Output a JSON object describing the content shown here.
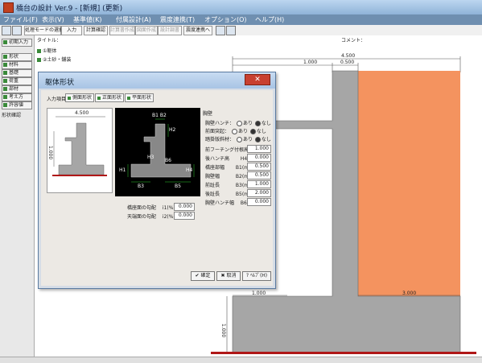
{
  "window": {
    "title": "橋台の設計 Ver.9 - [新規] (更新)"
  },
  "menu": [
    "ファイル(F)",
    "表示(V)",
    "基準値(K)",
    "付属設計(A)",
    "震度連携(T)",
    "オプション(O)",
    "ヘルプ(H)"
  ],
  "toolbar": {
    "mode_label": "処理モードの選択",
    "input": "入力",
    "calc_confirm": "計算確認",
    "result1": "計算書作成",
    "result2": "図面作成",
    "result3": "設計調書",
    "quake": "震度連携へ"
  },
  "left": {
    "initial": "初期入力",
    "items": [
      "形状",
      "材料",
      "基礎",
      "荷重",
      "部材",
      "考え方",
      "許容値"
    ],
    "shape_confirm": "形状確認"
  },
  "header": {
    "title_col": "タイトル：",
    "comment_col": "コメント："
  },
  "tree": [
    "①躯体",
    "②土砂・舗装"
  ],
  "dims": {
    "top_total": "4.500",
    "top_left": "1.000",
    "top_right": "0.500",
    "bottom_left": "1.000",
    "bottom_right": "3.000",
    "side_bottom": "1.000"
  },
  "dialog": {
    "title": "躯体形状",
    "input_items_label": "入力項目：",
    "tabs": [
      "側面形状",
      "正面形状",
      "平面形状"
    ],
    "thumb_dim_top": "4.500",
    "thumb_dim_side": "1.000",
    "schematic_labels": {
      "b1b2": "B1 B2",
      "h2": "H2",
      "h1": "H1",
      "b3": "B3",
      "b5": "B5",
      "b6": "B6",
      "h3": "H3",
      "h4": "H4"
    },
    "props_title": "胸壁",
    "radios": [
      {
        "label": "胸壁ハンチ：",
        "opt1": "あり",
        "opt2": "なし"
      },
      {
        "label": "前面突起：",
        "opt1": "あり",
        "opt2": "なし"
      },
      {
        "label": "踏掛版斜材：",
        "opt1": "あり",
        "opt2": "なし"
      }
    ],
    "params": [
      {
        "label": "前フーチング付根高 H1(m)",
        "value": "1.000"
      },
      {
        "label": "後ハンチ高　　 H4(m)",
        "value": "0.000"
      },
      {
        "label": "橋座部幅　　 B1(m)",
        "value": "0.500"
      },
      {
        "label": "胸壁幅　　　 B2(m)",
        "value": "0.500"
      },
      {
        "label": "前趾長　　　 B3(m)",
        "value": "1.000"
      },
      {
        "label": "後趾長　　　 B5(m)",
        "value": "2.000"
      },
      {
        "label": "胸壁ハンチ幅　 B6(m)",
        "value": "0.000"
      }
    ],
    "slopes": [
      {
        "label": "橋座面の勾配　 i1(%)",
        "value": "0.000"
      },
      {
        "label": "天端面の勾配　 i2(%)",
        "value": "0.000"
      }
    ],
    "ok": "確定",
    "cancel": "取消",
    "help": "ﾍﾙﾌﾟ(H)"
  },
  "colors": {
    "menubar": "#6f8fb0",
    "salmon": "#f4935f",
    "concrete": "#a6a6a6",
    "ground": "#b01818"
  }
}
